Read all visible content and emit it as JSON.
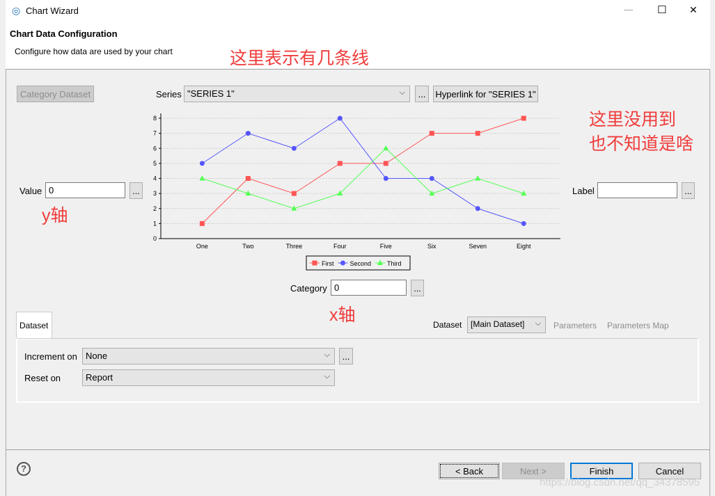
{
  "window": {
    "title": "Chart Wizard",
    "minimize": "—",
    "maximize": "☐",
    "close": "✕"
  },
  "header": {
    "title": "Chart Data Configuration",
    "subtitle": "Configure how data are used by your chart"
  },
  "category_dataset_button": "Category Dataset",
  "series": {
    "label": "Series",
    "value": "\"SERIES 1\"",
    "more": "...",
    "hyperlink": "Hyperlink for \"SERIES 1\""
  },
  "value": {
    "label": "Value",
    "value": "0",
    "more": "..."
  },
  "label_field": {
    "label": "Label",
    "value": "",
    "more": "..."
  },
  "category": {
    "label": "Category",
    "value": "0",
    "more": "..."
  },
  "annotations": {
    "lines": "这里表示有几条线",
    "unused_1": "这里没用到",
    "unused_2": "也不知道是啥",
    "y_axis": "y轴",
    "x_axis": "x轴"
  },
  "tabs": {
    "dataset": "Dataset",
    "dataset_label": "Dataset",
    "dataset_value": "[Main Dataset]",
    "parameters": "Parameters",
    "parameters_map": "Parameters Map"
  },
  "increment": {
    "label": "Increment on",
    "value": "None",
    "more": "..."
  },
  "reset": {
    "label": "Reset on",
    "value": "Report"
  },
  "footer": {
    "back": "< Back",
    "next": "Next >",
    "finish": "Finish",
    "cancel": "Cancel",
    "help": "?",
    "watermark": "https://blog.csdn.net/qq_34378595"
  },
  "colors": {
    "first": "#ff5555",
    "second": "#5555ff",
    "third": "#55ff55"
  },
  "chart_data": {
    "type": "line",
    "categories": [
      "One",
      "Two",
      "Three",
      "Four",
      "Five",
      "Six",
      "Seven",
      "Eight"
    ],
    "ylim": [
      0,
      8
    ],
    "yticks": [
      0,
      1,
      2,
      3,
      4,
      5,
      6,
      7,
      8
    ],
    "grid": true,
    "legend": "bottom",
    "series": [
      {
        "name": "First",
        "marker": "square",
        "color": "#ff5555",
        "values": [
          1,
          4,
          3,
          5,
          5,
          7,
          7,
          8
        ]
      },
      {
        "name": "Second",
        "marker": "circle",
        "color": "#5555ff",
        "values": [
          5,
          7,
          6,
          8,
          4,
          4,
          2,
          1
        ]
      },
      {
        "name": "Third",
        "marker": "triangle",
        "color": "#55ff55",
        "values": [
          4,
          3,
          2,
          3,
          6,
          3,
          4,
          3
        ]
      }
    ]
  }
}
